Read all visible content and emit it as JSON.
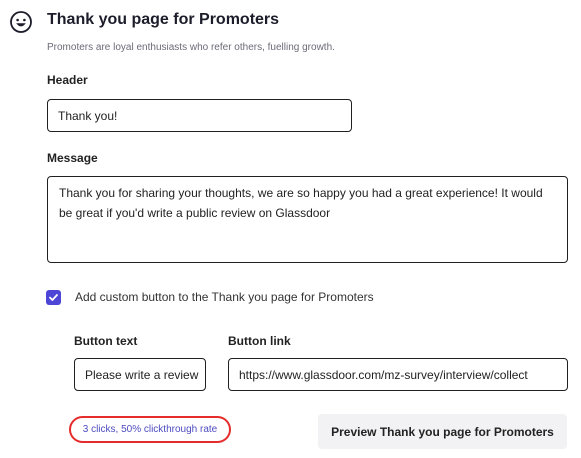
{
  "section": {
    "title": "Thank you page for Promoters",
    "description": "Promoters are loyal enthusiasts who refer others, fuelling growth."
  },
  "header_field": {
    "label": "Header",
    "value": "Thank you!"
  },
  "message_field": {
    "label": "Message",
    "value": "Thank you for sharing your thoughts, we are so happy you had a great experience! It would be great if you'd write a public review on Glassdoor"
  },
  "custom_button": {
    "checked": true,
    "label": "Add custom button to the Thank you page for Promoters",
    "button_text_label": "Button text",
    "button_text_value": "Please write a review",
    "button_link_label": "Button link",
    "button_link_value": "https://www.glassdoor.com/mz-survey/interview/collect"
  },
  "stats": {
    "text": "3 clicks, 50% clickthrough rate",
    "highlight_color": "#e52b2b"
  },
  "preview_button": {
    "label": "Preview Thank you page for Promoters"
  },
  "colors": {
    "accent": "#4c45d6"
  },
  "icons": {
    "header_icon": "smiley-face-icon",
    "checkbox_icon": "checkmark-icon"
  }
}
